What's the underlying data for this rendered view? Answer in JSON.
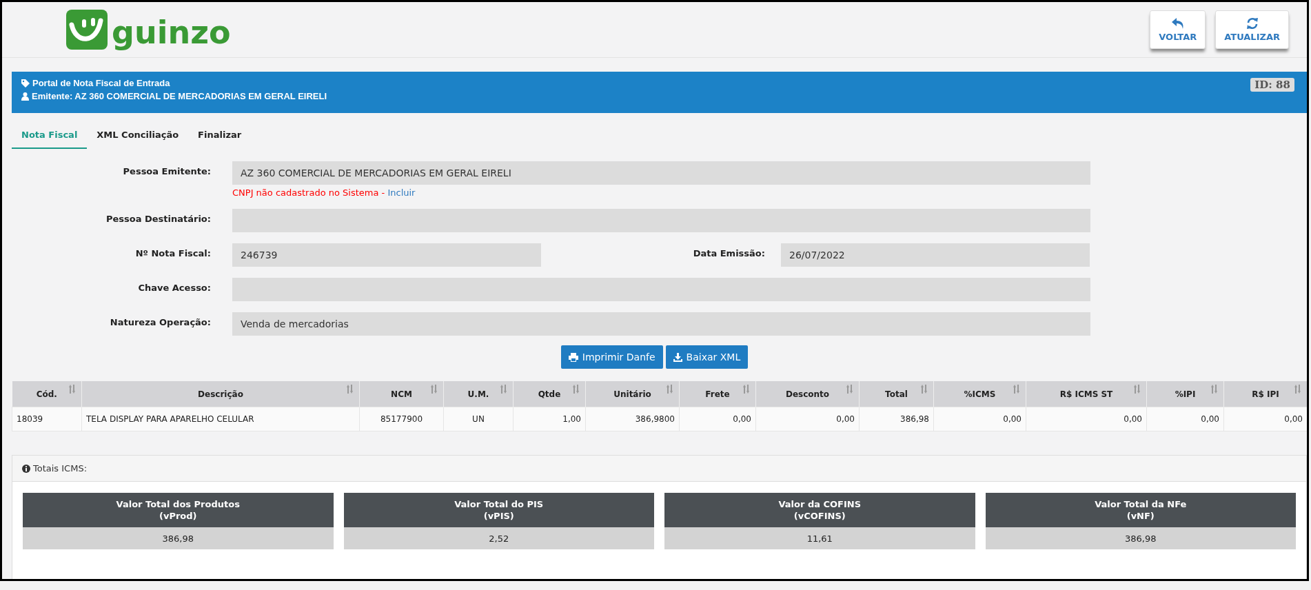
{
  "logo": {
    "text": "guinzo"
  },
  "header_buttons": [
    {
      "label": "VOLTAR",
      "kind": "back"
    },
    {
      "label": "ATUALIZAR",
      "kind": "refresh"
    }
  ],
  "banner": {
    "title": "Portal de Nota Fiscal de Entrada",
    "subtitle": "Emitente: AZ 360 COMERCIAL DE MERCADORIAS EM GERAL EIRELI",
    "id_badge": "ID: 88"
  },
  "tabs": [
    {
      "label": "Nota Fiscal",
      "selected": true
    },
    {
      "label": "XML Conciliação",
      "selected": false
    },
    {
      "label": "Finalizar",
      "selected": false
    }
  ],
  "form": {
    "rows": [
      {
        "fields": [
          {
            "label": "Pessoa Emitente:",
            "value": "AZ 360 COMERCIAL DE MERCADORIAS EM GERAL EIRELI"
          }
        ],
        "note": {
          "error": "CNPJ não cadastrado no Sistema - ",
          "link": "Incluir"
        }
      },
      {
        "fields": [
          {
            "label": "Pessoa Destinatário:"
          }
        ]
      },
      {
        "fields": [
          {
            "label": "Nº Nota Fiscal:",
            "value": "246739"
          },
          {
            "label": "Data Emissão:",
            "value": "26/07/2022"
          }
        ]
      },
      {
        "fields": [
          {
            "label": "Chave Acesso:"
          }
        ]
      },
      {
        "fields": [
          {
            "label": "Natureza Operação:",
            "value": "Venda de mercadorias"
          }
        ]
      }
    ]
  },
  "actions": [
    {
      "label": "Imprimir Danfe",
      "kind": "print"
    },
    {
      "label": "Baixar XML",
      "kind": "download"
    }
  ],
  "table": {
    "columns": [
      {
        "label": "Cód.",
        "kind": "text"
      },
      {
        "label": "Descrição",
        "kind": "text"
      },
      {
        "label": "NCM",
        "kind": "center"
      },
      {
        "label": "U.M.",
        "kind": "center"
      },
      {
        "label": "Qtde",
        "kind": "number"
      },
      {
        "label": "Unitário",
        "kind": "number"
      },
      {
        "label": "Frete",
        "kind": "number"
      },
      {
        "label": "Desconto",
        "kind": "number"
      },
      {
        "label": "Total",
        "kind": "number"
      },
      {
        "label": "%ICMS",
        "kind": "number"
      },
      {
        "label": "R$ ICMS ST",
        "kind": "number"
      },
      {
        "label": "%IPI",
        "kind": "number"
      },
      {
        "label": "R$ IPI",
        "kind": "number"
      }
    ],
    "rows": [
      [
        "18039",
        "TELA DISPLAY PARA APARELHO CELULAR",
        "85177900",
        "UN",
        "1,00",
        "386,9800",
        "0,00",
        "0,00",
        "386,98",
        "0,00",
        "0,00",
        "0,00",
        "0,00"
      ]
    ]
  },
  "totals": {
    "title": "Totais ICMS:",
    "cards": [
      {
        "title": "Valor Total dos Produtos",
        "code": "(vProd)",
        "value": "386,98"
      },
      {
        "title": "Valor Total do PIS",
        "code": "(vPIS)",
        "value": "2,52"
      },
      {
        "title": "Valor da COFINS",
        "code": "(vCOFINS)",
        "value": "11,61"
      },
      {
        "title": "Valor Total da NFe",
        "code": "(vNF)",
        "value": "386,98"
      }
    ]
  }
}
